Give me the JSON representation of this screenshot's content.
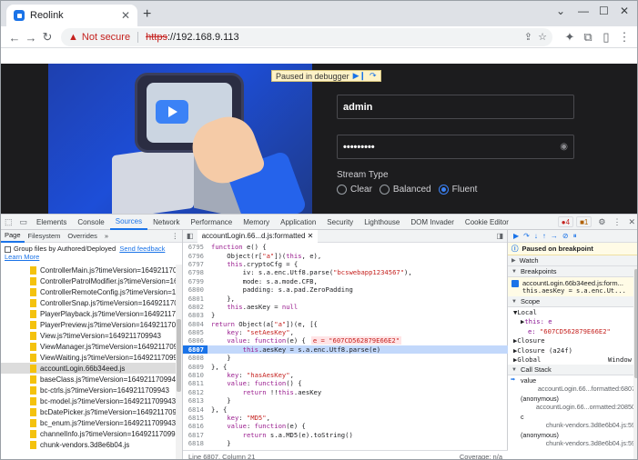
{
  "browser": {
    "tab_title": "Reolink",
    "url_warning": "Not secure",
    "url_scheme": "https",
    "url_rest": "://192.168.9.113"
  },
  "page": {
    "paused_label": "Paused in debugger",
    "username_value": "admin",
    "password_value": "•••••••••",
    "stream_type_label": "Stream Type",
    "stream_options": [
      "Clear",
      "Balanced",
      "Fluent"
    ],
    "stream_selected": "Fluent"
  },
  "devtools": {
    "tabs": [
      "Elements",
      "Console",
      "Sources",
      "Network",
      "Performance",
      "Memory",
      "Application",
      "Security",
      "Lighthouse",
      "DOM Invader",
      "Cookie Editor"
    ],
    "active_tab": "Sources",
    "error_count": "4",
    "warning_count": "1",
    "navigator": {
      "tabs": [
        "Page",
        "Filesystem",
        "Overrides"
      ],
      "group_label": "Group files by Authored/Deployed",
      "send_feedback": "Send feedback",
      "learn_more": "Learn More",
      "files": [
        "ControllerMain.js?timeVersion=164921170994",
        "ControllerPatrolModifier.js?timeVersion=164",
        "ControllerRemoteConfig.js?timeVersion=1649",
        "ControllerSnap.js?timeVersion=1649211709",
        "PlayerPlayback.js?timeVersion=164921170994",
        "PlayerPreview.js?timeVersion=1649211709943",
        "View.js?timeVersion=1649211709943",
        "ViewManager.js?timeVersion=164921170994",
        "ViewWaiting.js?timeVersion=1649211709943",
        "accountLogin.66b34eed.js",
        "baseClass.js?timeVersion=1649211709943",
        "bc-ctrls.js?timeVersion=1649211709943",
        "bc-model.js?timeVersion=1649211709943",
        "bcDatePicker.js?timeVersion=164921170994",
        "bc_enum.js?timeVersion=1649211709943",
        "channelInfo.js?timeVersion=164921170994",
        "chunk-vendors.3d8e6b04.js"
      ],
      "selected_file": "accountLogin.66b34eed.js"
    },
    "editor": {
      "tab_label": "accountLogin.66...d.js:formatted",
      "status_left": "Line 6807, Column 21",
      "status_right": "Coverage: n/a",
      "exec_line": 6807,
      "lines": [
        {
          "n": "6795",
          "t": "function e() {"
        },
        {
          "n": "6796",
          "t": "    Object(r[\"a\"])(this, e),"
        },
        {
          "n": "6797",
          "t": "    this.cryptoCfg = {"
        },
        {
          "n": "6798",
          "t": "        iv: s.a.enc.Utf8.parse(\"bcswebapp1234567\"),"
        },
        {
          "n": "6799",
          "t": "        mode: s.a.mode.CFB,"
        },
        {
          "n": "6800",
          "t": "        padding: s.a.pad.ZeroPadding"
        },
        {
          "n": "6801",
          "t": "    },"
        },
        {
          "n": "6802",
          "t": "    this.aesKey = null"
        },
        {
          "n": "6803",
          "t": "}"
        },
        {
          "n": "6804",
          "t": "return Object(a[\"a\"])(e, [{"
        },
        {
          "n": "6805",
          "t": "    key: \"setAesKey\","
        },
        {
          "n": "6806",
          "t": "    value: function(e) {"
        },
        {
          "n": "6807",
          "t": "        this.aesKey = s.a.enc.Utf8.parse(e)"
        },
        {
          "n": "6808",
          "t": "    }"
        },
        {
          "n": "6809",
          "t": "}, {"
        },
        {
          "n": "6810",
          "t": "    key: \"hasAesKey\","
        },
        {
          "n": "6811",
          "t": "    value: function() {"
        },
        {
          "n": "6812",
          "t": "        return !!this.aesKey"
        },
        {
          "n": "6813",
          "t": "    }"
        },
        {
          "n": "6814",
          "t": "}, {"
        },
        {
          "n": "6815",
          "t": "    key: \"MD5\","
        },
        {
          "n": "6816",
          "t": "    value: function(e) {"
        },
        {
          "n": "6817",
          "t": "        return s.a.MD5(e).toString()"
        },
        {
          "n": "6818",
          "t": "    }"
        }
      ],
      "inline_value": "e = \"607CD562879E66E2\""
    },
    "debugger": {
      "paused_text": "Paused on breakpoint",
      "watch": "Watch",
      "breakpoints": "Breakpoints",
      "bp_file": "accountLogin.66b34eed.js:form...",
      "bp_code": "this.aesKey = s.a.enc.Ut...",
      "scope": "Scope",
      "local": "Local",
      "this_row": "this: e",
      "e_key": "e:",
      "e_val": "\"607CD562879E66E2\"",
      "closure1": "Closure",
      "closure2": "Closure (a24f)",
      "global": "Global",
      "global_val": "Window",
      "call_stack": "Call Stack",
      "stack": [
        {
          "fn": "value",
          "loc": "accountLogin.66...formatted:6807"
        },
        {
          "fn": "(anonymous)",
          "loc": "accountLogin.66...ormatted:20850"
        },
        {
          "fn": "c",
          "loc": "chunk-vendors.3d8e6b04.js:59"
        },
        {
          "fn": "(anonymous)",
          "loc": "chunk-vendors.3d8e6b04.js:59"
        }
      ]
    }
  }
}
